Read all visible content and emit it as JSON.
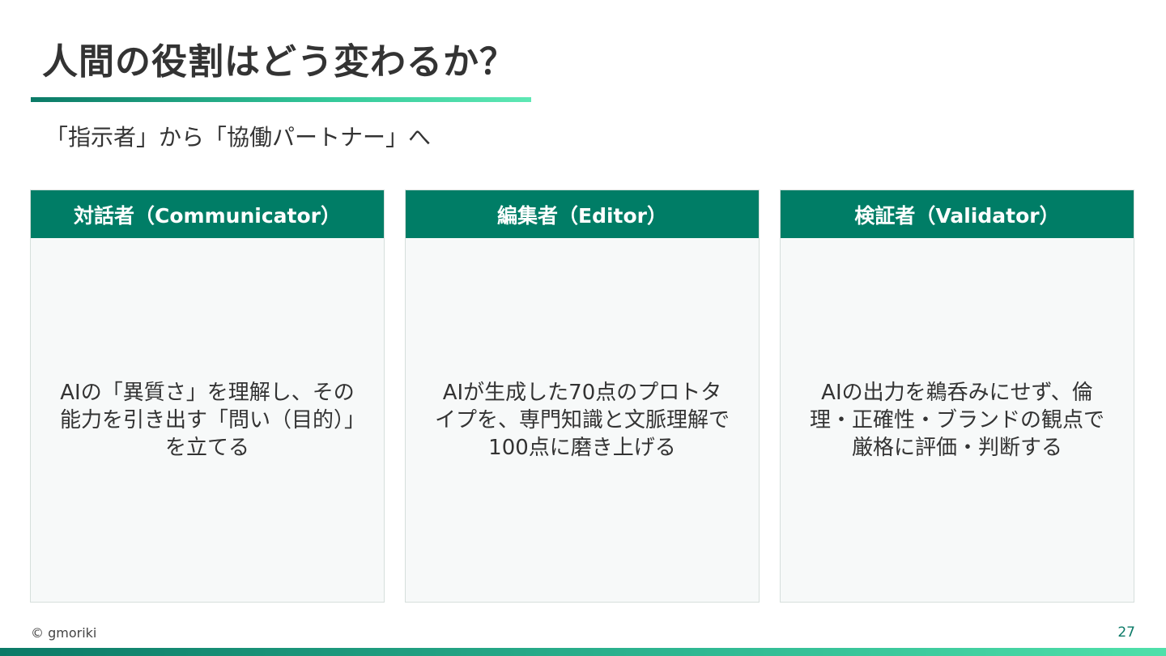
{
  "slide": {
    "title": "人間の役割はどう変わるか？",
    "subtitle": "「指示者」から「協働パートナー」へ",
    "footer": {
      "copyright": "© gmoriki",
      "page_number": "27"
    }
  },
  "cards": [
    {
      "heading": "対話者（Communicator）",
      "body": "AIの「異質さ」を理解し、その能力を引き出す「問い（目的）」を立てる"
    },
    {
      "heading": "編集者（Editor）",
      "body": "AIが生成した70点のプロトタイプを、専門知識と文脈理解で100点に磨き上げる"
    },
    {
      "heading": "検証者（Validator）",
      "body": "AIの出力を鵜呑みにせず、倫理・正確性・ブランドの観点で厳格に評価・判断する"
    }
  ],
  "colors": {
    "accent": "#007d66",
    "card_background": "#f7f9f9",
    "text": "#333333"
  }
}
